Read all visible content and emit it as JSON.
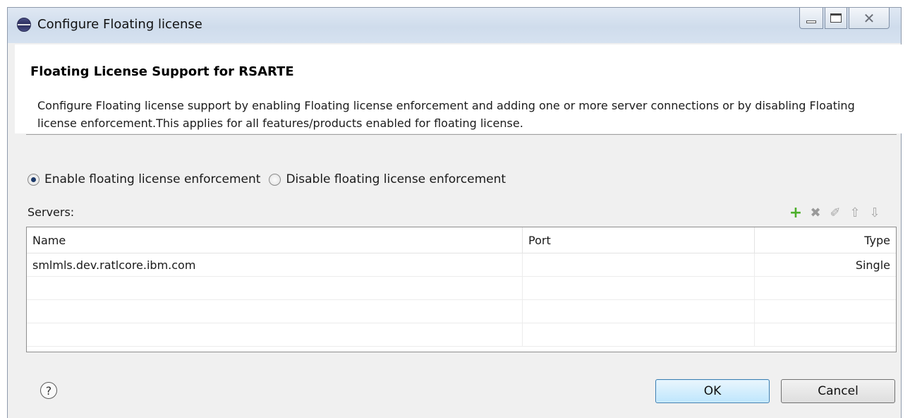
{
  "window": {
    "title": "Configure Floating license",
    "minimize": "minimize",
    "maximize": "maximize",
    "close_glyph": "✕"
  },
  "banner": {
    "title": "Floating License Support for RSARTE",
    "description": "Configure Floating license support by enabling Floating license enforcement and adding one or more server connections or by disabling Floating license enforcement.This applies for all features/products enabled for floating license."
  },
  "enforcement": {
    "options": [
      {
        "label": "Enable floating license enforcement",
        "checked": true
      },
      {
        "label": "Disable floating license enforcement",
        "checked": false
      }
    ]
  },
  "servers": {
    "label": "Servers:",
    "toolbar": {
      "add": "+",
      "remove": "✖",
      "edit": "✐",
      "up": "⇧",
      "down": "⇩"
    },
    "columns": [
      "Name",
      "Port",
      "Type"
    ],
    "rows": [
      [
        "smlmls.dev.ratlcore.ibm.com",
        "",
        "Single"
      ],
      [
        "",
        "",
        ""
      ],
      [
        "",
        "",
        ""
      ],
      [
        "",
        "",
        ""
      ]
    ]
  },
  "footer": {
    "help": "?",
    "ok_label": "OK",
    "cancel_label": "Cancel"
  },
  "colors": {
    "ok_border": "#3c7fb1",
    "add_icon": "#4caf2a",
    "radio_dot": "#1e3b6a"
  }
}
